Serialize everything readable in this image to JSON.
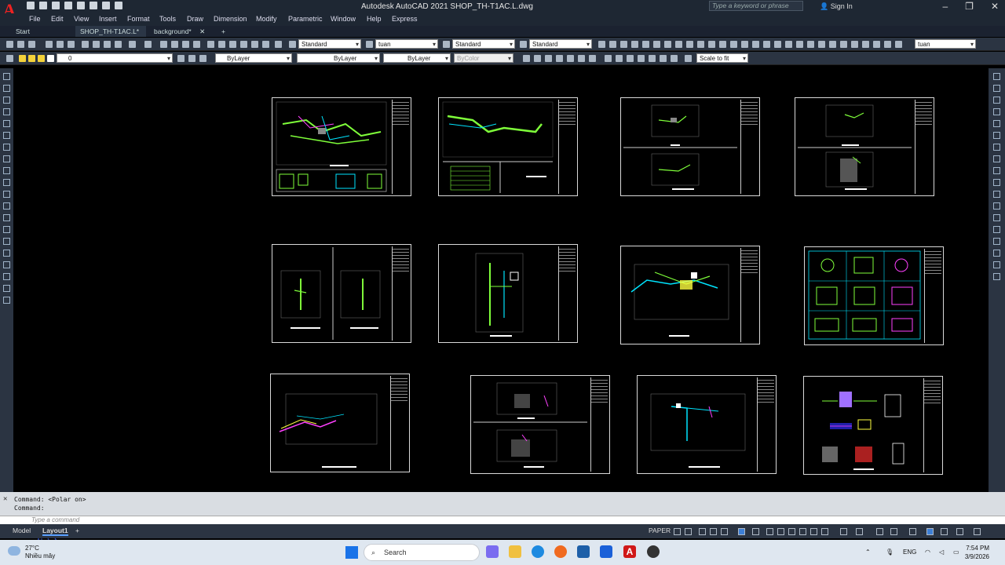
{
  "app": {
    "title": "Autodesk AutoCAD 2021    SHOP_TH-T1AC.L.dwg",
    "search_placeholder": "Type a keyword or phrase",
    "signin": "Sign In"
  },
  "menu": [
    "File",
    "Edit",
    "View",
    "Insert",
    "Format",
    "Tools",
    "Draw",
    "Dimension",
    "Modify",
    "Parametric",
    "Window",
    "Help",
    "Express"
  ],
  "tabs": [
    "Start",
    "SHOP_TH-T1AC.L*",
    "background*"
  ],
  "toolbar": {
    "text_style": "Standard",
    "dim_style": "tuan",
    "table_style": "Standard",
    "mleader_style": "Standard",
    "anno_scale": "tuan",
    "layer": "0",
    "color": "ByLayer",
    "linetype": "ByLayer",
    "lineweight": "ByLayer",
    "plotstyle": "ByColor",
    "viewport_scale": "Scale to fit"
  },
  "command": {
    "history_1": "Command:  <Polar on>",
    "history_2": "Command:",
    "prompt": "Type a command"
  },
  "status": {
    "model_tab": "Model",
    "layout_tab": "Layout1",
    "space": "PAPER"
  },
  "taskbar": {
    "temp": "27°C",
    "weather": "Nhiều mây",
    "search": "Search",
    "lang": "ENG",
    "time": "7:54 PM",
    "date": "3/9/2026"
  },
  "colors": {
    "drawing_green": "#7fff3a",
    "drawing_cyan": "#00e5ff",
    "drawing_magenta": "#ff40ff",
    "drawing_yellow": "#ffff40",
    "sheet_border": "#d9d9d9"
  }
}
